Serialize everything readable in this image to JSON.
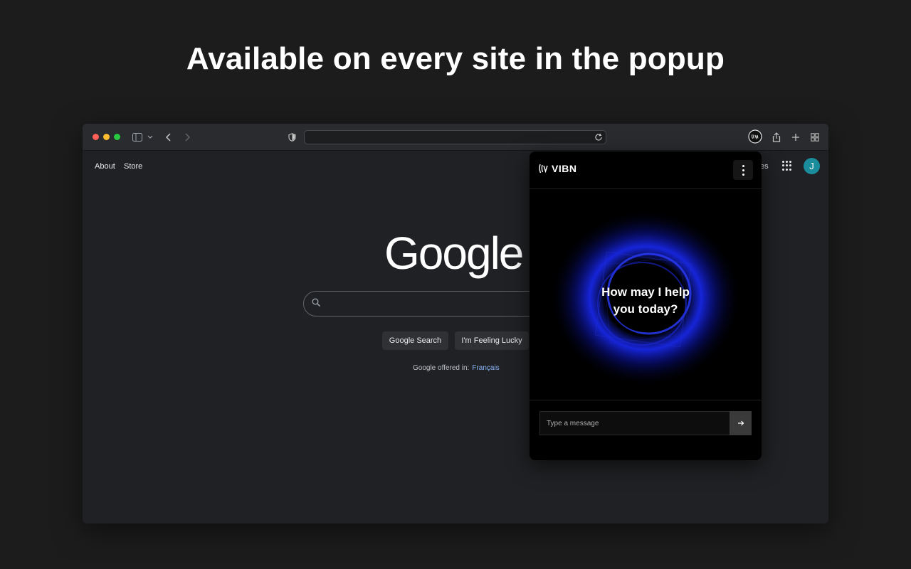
{
  "headline": "Available on every site in the popup",
  "browser": {
    "url": "",
    "nav_links": [
      "About",
      "Store"
    ],
    "images_fragment": "es",
    "avatar_initial": "J"
  },
  "google": {
    "logo_text": "Google",
    "search_button": "Google Search",
    "lucky_button": "I'm Feeling Lucky",
    "offered_in": "Google offered in:",
    "offered_language": "Français"
  },
  "popup": {
    "brand": "VIBN",
    "greeting_line1": "How may I help",
    "greeting_line2": "you today?",
    "input_placeholder": "Type a message"
  },
  "colors": {
    "background": "#1c1c1c",
    "browser_bg": "#202124",
    "popup_bg": "#000000",
    "orb_glow": "#1a2bff",
    "link_blue": "#8ab4f8",
    "avatar_teal": "#1a8c9c"
  },
  "icons": [
    "sidebar-icon",
    "chevron-down-icon",
    "back-icon",
    "forward-icon",
    "shield-icon",
    "reload-icon",
    "vibn-extension-icon",
    "share-icon",
    "new-tab-icon",
    "tab-overview-icon",
    "apps-grid-icon",
    "search-icon",
    "vibn-logo-icon",
    "more-vert-icon",
    "send-arrow-icon"
  ]
}
